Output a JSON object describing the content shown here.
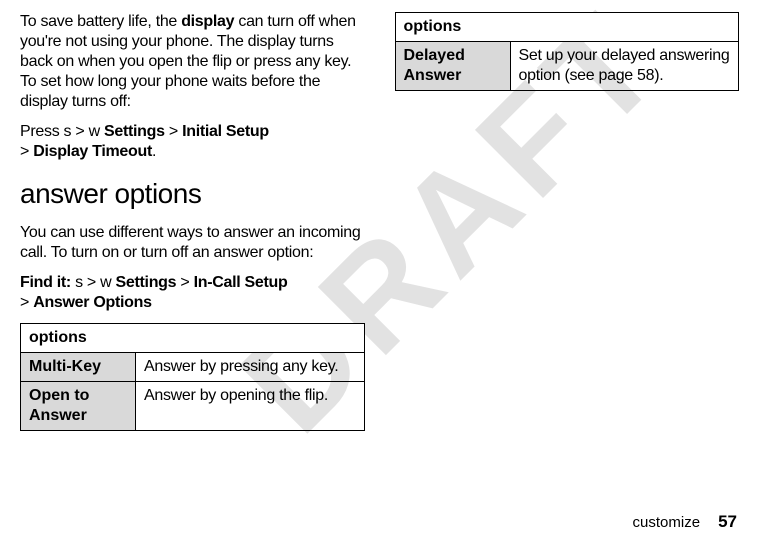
{
  "watermark": "DRAFT",
  "left": {
    "para1_pre": "To save battery life, the ",
    "para1_bold": "display",
    "para1_post": " can turn off when you're not using your phone. The display turns back on when you open the flip or press any key. To set how long your phone waits before the display turns off:",
    "press_lead": "Press ",
    "press_glyph1": "s",
    "press_gt1": " > ",
    "press_glyph2": "w",
    "press_settings": " Settings",
    "press_gt2": " > ",
    "press_initial": "Initial Setup",
    "press_gt3": "> ",
    "press_display": "Display Timeout",
    "press_period": ".",
    "heading": "answer options",
    "para2": "You can use different ways to answer an incoming call. To turn on or turn off an answer option:",
    "findit_label": "Find it: ",
    "findit_glyph1": "s",
    "findit_gt1": " > ",
    "findit_glyph2": "w",
    "findit_settings": " Settings",
    "findit_gt2": " > ",
    "findit_incall": "In-Call Setup",
    "findit_gt3": "> ",
    "findit_answer": "Answer Options",
    "table_header": "options",
    "row1_name": "Multi-Key",
    "row1_desc": "Answer by pressing any key.",
    "row2_name": "Open to Answer",
    "row2_desc": "Answer by opening the flip."
  },
  "right": {
    "table_header": "options",
    "row1_name": "Delayed Answer",
    "row1_desc": "Set up your delayed answering option (see page 58)."
  },
  "footer": {
    "label": "customize",
    "page": "57"
  }
}
